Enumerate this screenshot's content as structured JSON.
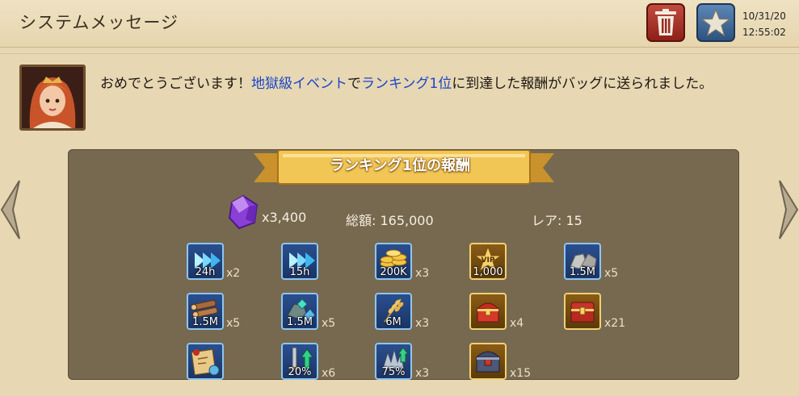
{
  "header": {
    "title": "システムメッセージ",
    "date": "10/31/20",
    "time": "12:55:02",
    "delete_icon": "trash-icon",
    "favorite_icon": "star-icon"
  },
  "message": {
    "part1": "おめでとうございます！",
    "link1": "地獄級イベント",
    "part2": "で",
    "link2": "ランキング1位",
    "part3": "に到達した報酬がバッグに送られました。",
    "link_color": "#1a46c9"
  },
  "reward": {
    "banner": "ランキング1位の報酬",
    "gems": "x3,400",
    "total": "総額: 165,000",
    "rarity": "レア: 15",
    "items": [
      {
        "label": "24h",
        "qty": "x2",
        "icon": "speedup-icon"
      },
      {
        "label": "15h",
        "qty": "",
        "icon": "speedup-icon"
      },
      {
        "label": "200K",
        "qty": "x3",
        "icon": "gold-coins-icon"
      },
      {
        "label": "1,000",
        "qty": "",
        "icon": "vip-points-icon"
      },
      {
        "label": "1.5M",
        "qty": "x5",
        "icon": "stone-icon"
      },
      {
        "label": "1.5M",
        "qty": "x5",
        "icon": "timber-icon"
      },
      {
        "label": "1.5M",
        "qty": "x5",
        "icon": "ore-icon"
      },
      {
        "label": "6M",
        "qty": "x3",
        "icon": "food-icon"
      },
      {
        "label": "",
        "qty": "x4",
        "icon": "red-chest-icon"
      },
      {
        "label": "",
        "qty": "x21",
        "icon": "treasure-chest-icon"
      },
      {
        "label": "",
        "qty": "",
        "icon": "scroll-map-icon"
      },
      {
        "label": "20%",
        "qty": "x6",
        "icon": "attack-boost-icon"
      },
      {
        "label": "75%",
        "qty": "x3",
        "icon": "boost-icon"
      },
      {
        "label": "",
        "qty": "x15",
        "icon": "armor-chest-icon"
      }
    ]
  },
  "nav": {
    "prev_icon": "arrow-left-icon",
    "next_icon": "arrow-right-icon"
  }
}
